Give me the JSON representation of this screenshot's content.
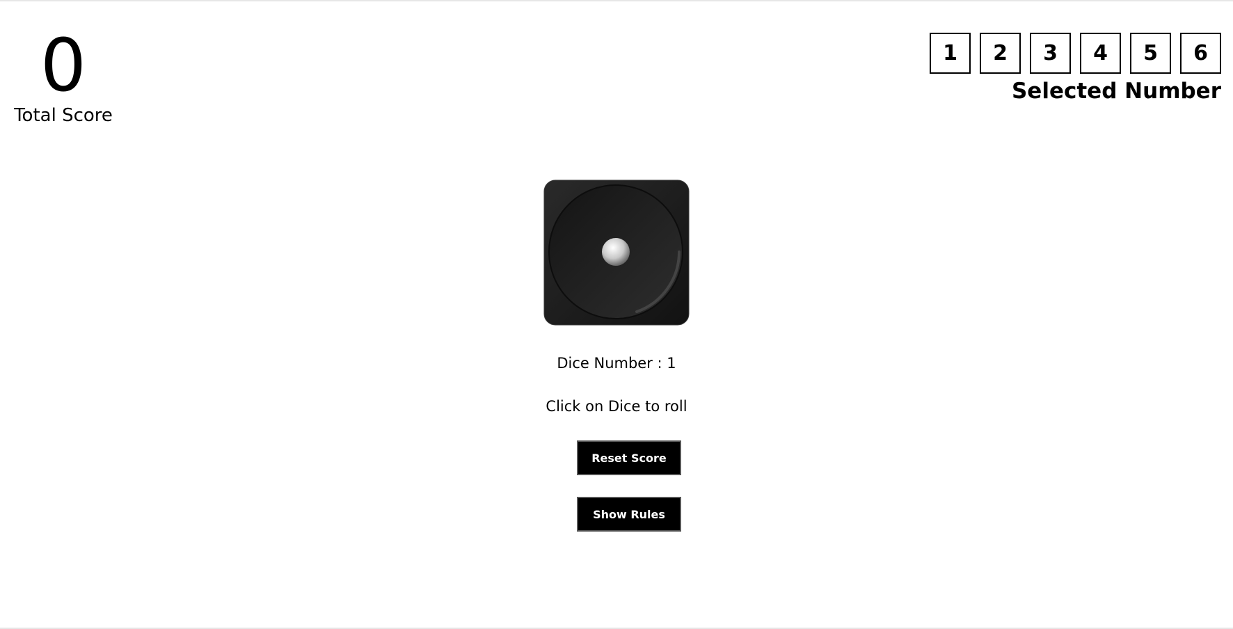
{
  "score": {
    "value": "0",
    "label": "Total Score"
  },
  "selector": {
    "numbers": [
      "1",
      "2",
      "3",
      "4",
      "5",
      "6"
    ],
    "label": "Selected Number"
  },
  "dice": {
    "face": 1,
    "icon": "dice-face-one-icon"
  },
  "status": {
    "dice_number": "Dice Number : 1",
    "hint": "Click on Dice to roll"
  },
  "buttons": {
    "reset": "Reset Score",
    "rules": "Show Rules"
  },
  "colors": {
    "text": "#000000",
    "button_bg": "#000000",
    "button_text": "#ffffff",
    "dice_body": "#1f1f1f"
  }
}
